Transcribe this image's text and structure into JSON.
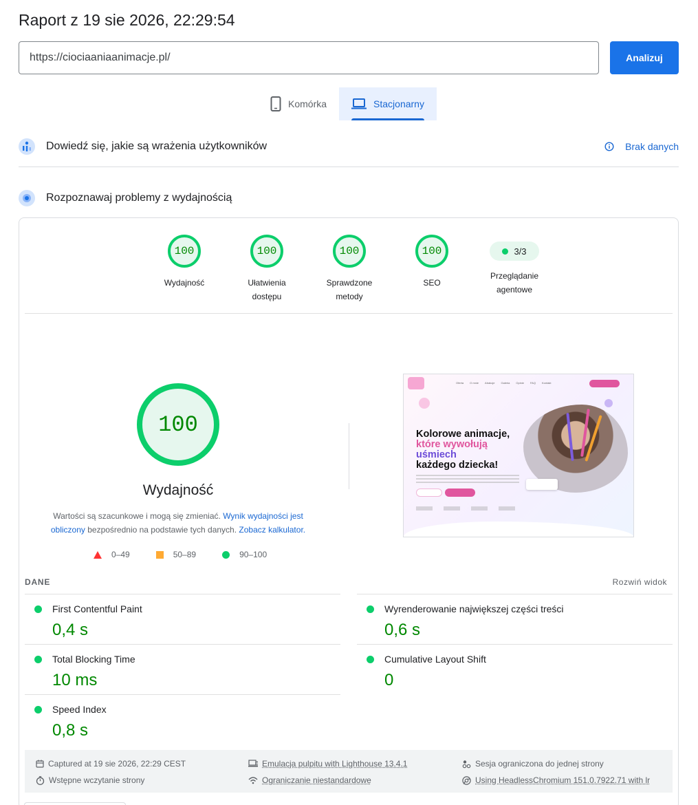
{
  "header": {
    "title": "Raport z 19 sie 2026, 22:29:54"
  },
  "search": {
    "url_value": "https://ciociaaniaanimacje.pl/",
    "analyze_label": "Analizuj"
  },
  "tabs": [
    {
      "label": "Komórka",
      "icon": "smartphone-icon",
      "active": false
    },
    {
      "label": "Stacjonarny",
      "icon": "laptop-icon",
      "active": true
    }
  ],
  "field_data": {
    "title": "Dowiedź się, jakie są wrażenia użytkowników",
    "status": "Brak danych"
  },
  "lab": {
    "title": "Rozpoznawaj problemy z wydajnością"
  },
  "categories": [
    {
      "score": "100",
      "label": "Wydajność"
    },
    {
      "score": "100",
      "label": "Ułatwienia dostępu"
    },
    {
      "score": "100",
      "label": "Sprawdzone metody"
    },
    {
      "score": "100",
      "label": "SEO"
    },
    {
      "score": "3/3",
      "label": "Przeglądanie agentowe"
    }
  ],
  "performance": {
    "score": "100",
    "label": "Wydajność",
    "desc_prefix": "Wartości są szacunkowe i mogą się zmieniać. ",
    "desc_link1": "Wynik wydajności jest obliczony",
    "desc_middle": " bezpośrednio na podstawie tych danych. ",
    "desc_link2": "Zobacz kalkulator.",
    "legend": [
      {
        "range": "0–49",
        "color": "#ff3333"
      },
      {
        "range": "50–89",
        "color": "#ffaa33"
      },
      {
        "range": "90–100",
        "color": "#0cce6b"
      }
    ]
  },
  "thumbnail": {
    "nav_links": [
      "Oferta",
      "O mnie",
      "Atrakcje",
      "Galeria",
      "Opinie",
      "FAQ",
      "Kontakt"
    ],
    "headline_1": "Kolorowe animacje,",
    "headline_2": "które wywołują",
    "headline_3": "uśmiech",
    "headline_4": "każdego dziecka!"
  },
  "metrics": {
    "section_label": "DANE",
    "expand_label": "Rozwiń widok",
    "items": [
      {
        "name": "First Contentful Paint",
        "value": "0,4 s"
      },
      {
        "name": "Wyrenderowanie największej części treści",
        "value": "0,6 s"
      },
      {
        "name": "Total Blocking Time",
        "value": "10 ms"
      },
      {
        "name": "Cumulative Layout Shift",
        "value": "0"
      },
      {
        "name": "Speed Index",
        "value": "0,8 s"
      }
    ]
  },
  "footer": {
    "captured": "Captured at 19 sie 2026, 22:29 CEST",
    "initial_load": "Wstępne wczytanie strony",
    "emulation": "Emulacja pulpitu with Lighthouse 13.4.1",
    "throttling": "Ograniczanie niestandardowe",
    "session": "Sesja ograniczona do jednej strony",
    "browser": "Using HeadlessChromium 151.0.7922.71 with lr"
  },
  "colors": {
    "accent": "#1a73e8",
    "pass": "#0cce6b",
    "pass_text": "#008800",
    "average": "#ffaa33",
    "fail": "#ff3333"
  }
}
